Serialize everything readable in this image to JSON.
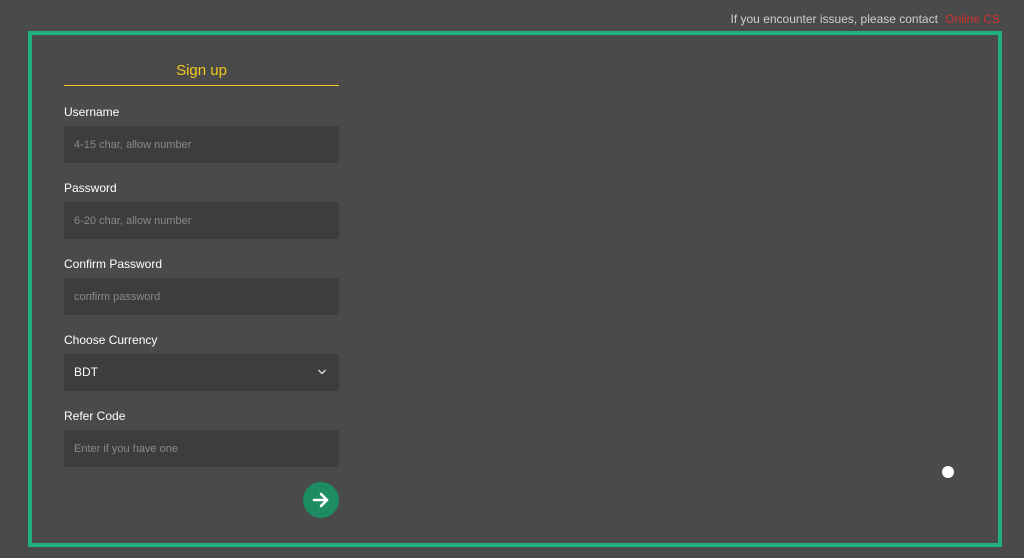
{
  "header": {
    "contact_text": "If you encounter issues, please contact",
    "contact_link": "Online CS"
  },
  "signup": {
    "title": "Sign up",
    "fields": {
      "username": {
        "label": "Username",
        "placeholder": "4-15 char, allow number"
      },
      "password": {
        "label": "Password",
        "placeholder": "6-20 char, allow number"
      },
      "confirm_password": {
        "label": "Confirm Password",
        "placeholder": "confirm password"
      },
      "currency": {
        "label": "Choose Currency",
        "value": "BDT"
      },
      "refer_code": {
        "label": "Refer Code",
        "placeholder": "Enter if you have one"
      }
    },
    "submit_icon": "arrow-right-icon"
  },
  "colors": {
    "background": "#4a4a4a",
    "frame_border": "#1fb07c",
    "title_accent": "#f2c81e",
    "input_bg": "#3d3d3d",
    "submit_bg": "#1d8c63",
    "contact_link": "#d0312d"
  }
}
